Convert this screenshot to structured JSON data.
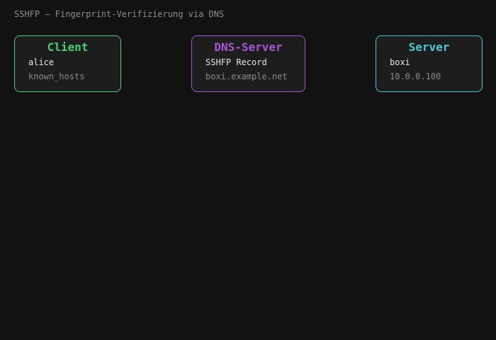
{
  "title": "SSHFP — Fingerprint-Verifizierung via DNS",
  "nodes": [
    {
      "title": "Client",
      "line1": "alice",
      "line2": "known_hosts",
      "color": "#4ecb7b"
    },
    {
      "title": "DNS-Server",
      "line1": "SSHFP Record",
      "line2": "boxi.example.net",
      "color": "#a855d6"
    },
    {
      "title": "Server",
      "line1": "boxi",
      "line2": "10.0.0.100",
      "color": "#4cc8d4"
    }
  ]
}
